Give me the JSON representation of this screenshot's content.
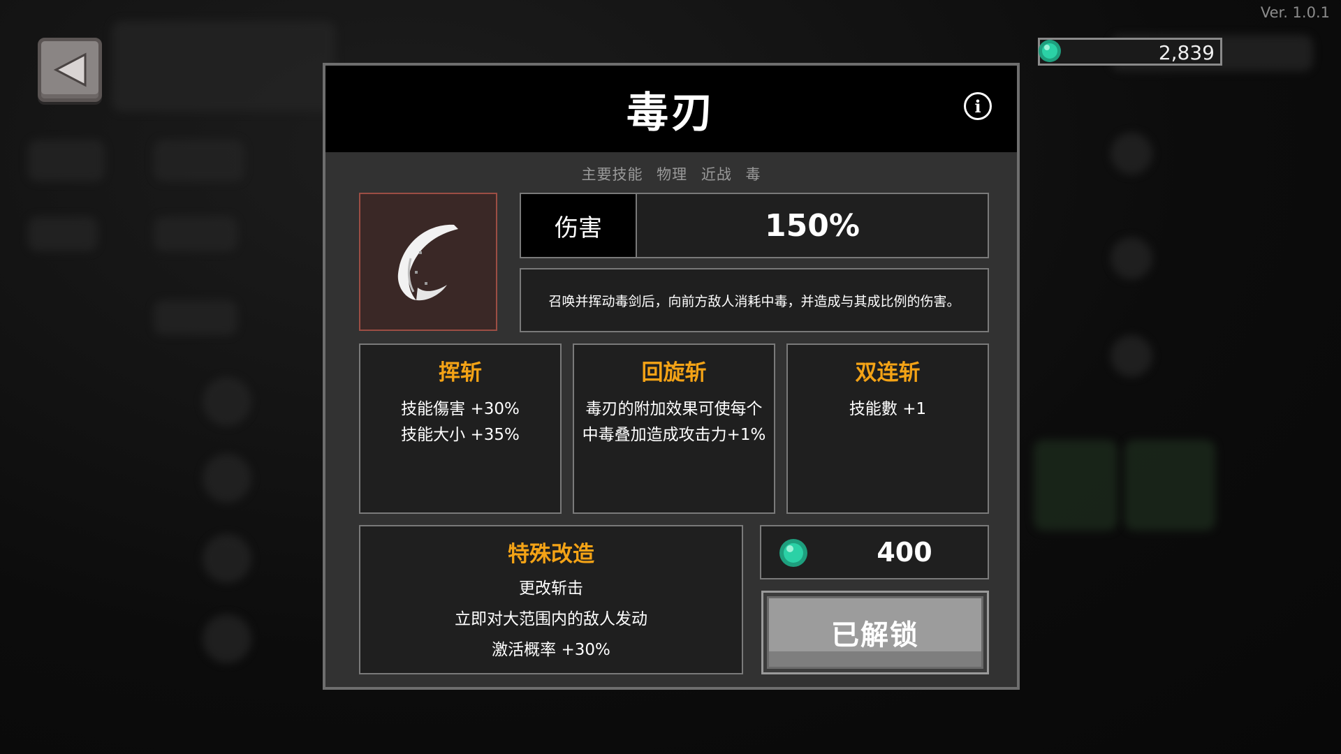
{
  "version": "Ver. 1.0.1",
  "currency": {
    "amount": "2,839",
    "icon": "gem-icon"
  },
  "modal": {
    "title": "毒刃",
    "tags": [
      "主要技能",
      "物理",
      "近战",
      "毒"
    ],
    "damage_label": "伤害",
    "damage_value": "150%",
    "description": "召唤并挥动毒剑后，向前方敌人消耗中毒，并造成与其成比例的伤害。",
    "upgrades": [
      {
        "name": "挥斩",
        "lines": [
          "技能傷害 +30%",
          "技能大小 +35%"
        ]
      },
      {
        "name": "回旋斩",
        "lines": [
          "毒刃的附加效果可使每个",
          "中毒叠加造成攻击力+1%"
        ]
      },
      {
        "name": "双连斩",
        "lines": [
          "技能數 +1"
        ]
      }
    ],
    "special": {
      "name": "特殊改造",
      "lines": [
        "更改斩击",
        "立即对大范围内的敌人发动",
        "激活概率 +30%"
      ]
    },
    "cost": "400",
    "unlock_label": "已解锁"
  },
  "colors": {
    "accent": "#f4a316",
    "gem": "#2bd1a6",
    "icon_border": "#9c4e44"
  }
}
